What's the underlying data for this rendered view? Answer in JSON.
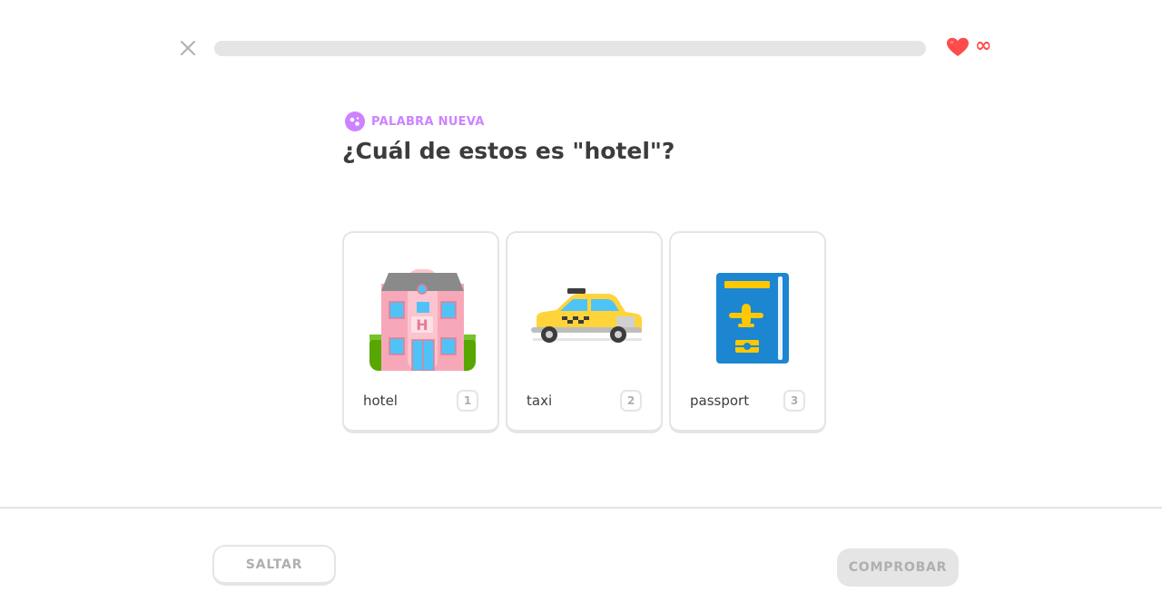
{
  "header": {
    "close_icon": "close-icon",
    "progress_percent": 0,
    "hearts_icon": "heart-icon",
    "hearts_count": "∞",
    "accent_color": "#58cc02",
    "heart_color": "#ff4b4b"
  },
  "challenge": {
    "badge_icon": "new-word-icon",
    "badge_label": "PALABRA NUEVA",
    "badge_color": "#ce82ff",
    "question": "¿Cuál de estos es \"hotel\"?"
  },
  "choices": [
    {
      "icon": "hotel-icon",
      "label": "hotel",
      "key": "1"
    },
    {
      "icon": "taxi-icon",
      "label": "taxi",
      "key": "2"
    },
    {
      "icon": "passport-icon",
      "label": "passport",
      "key": "3"
    }
  ],
  "footer": {
    "skip_label": "SALTAR",
    "check_label": "COMPROBAR"
  }
}
